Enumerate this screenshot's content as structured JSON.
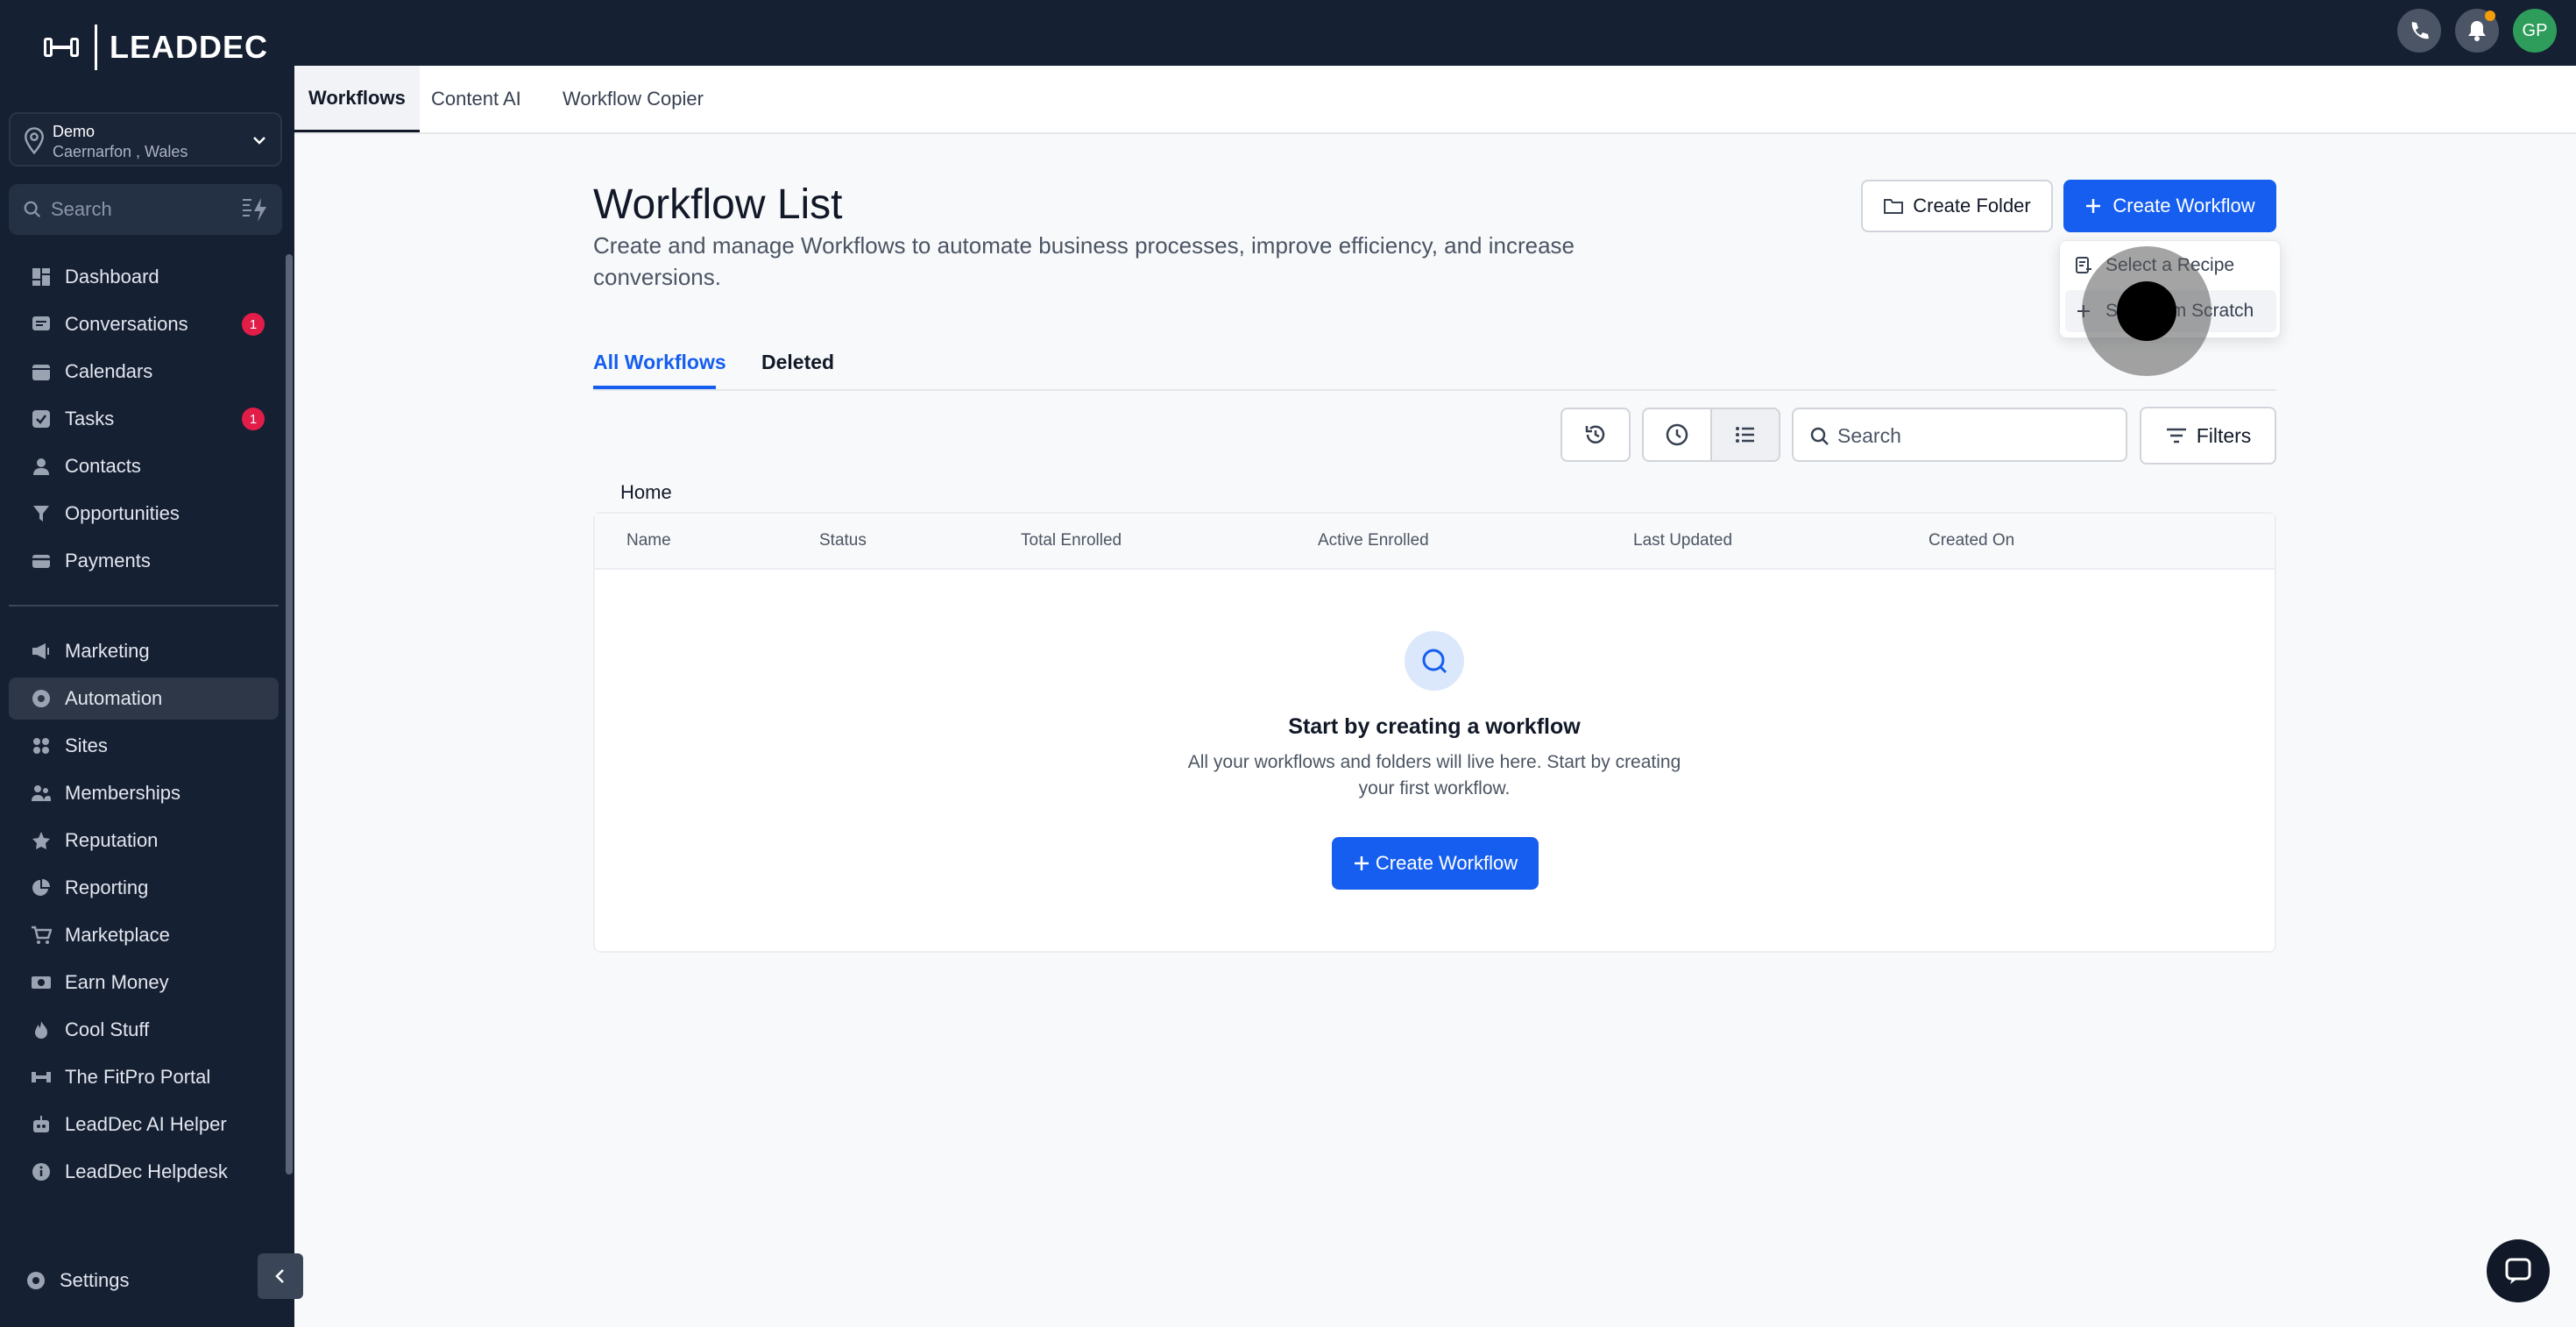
{
  "brand": {
    "name": "LEADDEC"
  },
  "location": {
    "name": "Demo",
    "subtitle": "Caernarfon , Wales"
  },
  "sidebar": {
    "search_placeholder": "Search",
    "items": [
      {
        "label": "Dashboard",
        "icon": "dashboard-icon"
      },
      {
        "label": "Conversations",
        "icon": "chat-icon",
        "badge": "1"
      },
      {
        "label": "Calendars",
        "icon": "calendar-icon"
      },
      {
        "label": "Tasks",
        "icon": "checkbox-icon",
        "badge": "1"
      },
      {
        "label": "Contacts",
        "icon": "person-icon"
      },
      {
        "label": "Opportunities",
        "icon": "filter-icon"
      },
      {
        "label": "Payments",
        "icon": "card-icon"
      },
      {
        "label": "Marketing",
        "icon": "megaphone-icon"
      },
      {
        "label": "Automation",
        "icon": "automation-icon",
        "active": true
      },
      {
        "label": "Sites",
        "icon": "globe-icon"
      },
      {
        "label": "Memberships",
        "icon": "people-icon"
      },
      {
        "label": "Reputation",
        "icon": "star-icon"
      },
      {
        "label": "Reporting",
        "icon": "pie-chart-icon"
      },
      {
        "label": "Marketplace",
        "icon": "cart-icon"
      },
      {
        "label": "Earn Money",
        "icon": "money-icon"
      },
      {
        "label": "Cool Stuff",
        "icon": "flame-icon"
      },
      {
        "label": "The FitPro Portal",
        "icon": "dumbbell-icon"
      },
      {
        "label": "LeadDec AI Helper",
        "icon": "robot-icon"
      },
      {
        "label": "LeadDec Helpdesk",
        "icon": "info-icon"
      }
    ],
    "settings_label": "Settings"
  },
  "topbar": {
    "avatar_initials": "GP"
  },
  "tabs": [
    "Workflows",
    "Content AI",
    "Workflow Copier"
  ],
  "page": {
    "title": "Workflow List",
    "description": "Create and manage Workflows to automate business processes, improve efficiency, and increase conversions.",
    "create_folder_label": "Create Folder",
    "create_workflow_label": "Create Workflow",
    "dropdown": [
      "Select a Recipe",
      "Start from Scratch"
    ],
    "subtabs": [
      "All Workflows",
      "Deleted"
    ],
    "search_placeholder": "Search",
    "filters_label": "Filters",
    "breadcrumb": "Home",
    "columns": [
      "Name",
      "Status",
      "Total Enrolled",
      "Active Enrolled",
      "Last Updated",
      "Created On"
    ],
    "empty_title": "Start by creating a workflow",
    "empty_desc": "All your workflows and folders will live here. Start by creating your first workflow.",
    "empty_button": "Create Workflow"
  },
  "colors": {
    "primary": "#155eef",
    "sidebar_bg": "#162033",
    "badge": "#e11d48"
  }
}
